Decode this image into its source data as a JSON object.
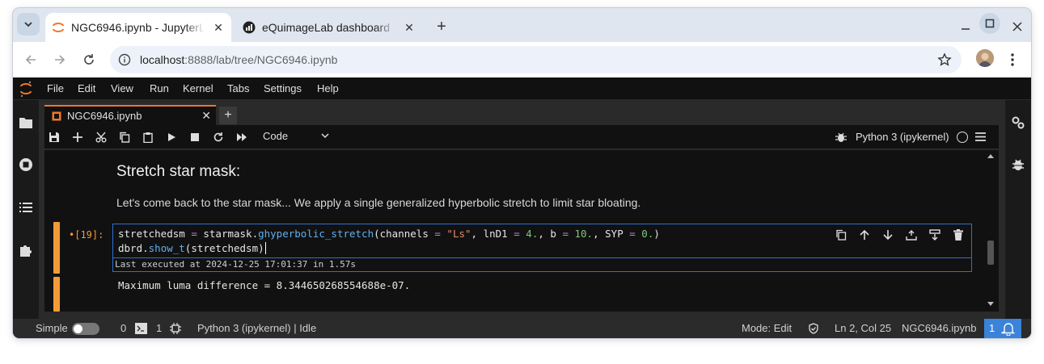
{
  "browser": {
    "tabs": [
      {
        "title": "NGC6946.ipynb - JupyterLab",
        "favicon": "jupyter-icon",
        "active": true
      },
      {
        "title": "eQuimageLab dashboard",
        "favicon": "dashboard-icon",
        "active": false
      }
    ],
    "new_tab": "+",
    "address": {
      "host": "localhost",
      "path": ":8888/lab/tree/NGC6946.ipynb"
    }
  },
  "jupyter": {
    "menu": [
      "File",
      "Edit",
      "View",
      "Run",
      "Kernel",
      "Tabs",
      "Settings",
      "Help"
    ],
    "doc_tab": {
      "title": "NGC6946.ipynb",
      "close": "✕",
      "add": "+"
    },
    "toolbar": {
      "cell_type": "Code",
      "kernel": "Python 3 (ipykernel)"
    },
    "markdown": {
      "heading": "Stretch star mask:",
      "paragraph": "Let's come back to the star mask... We apply a single generalized hyperbolic stretch to limit star bloating."
    },
    "cell": {
      "prompt": "•[19]:",
      "line1": {
        "a": "stretchedsm ",
        "eq": "=",
        "b": " starmask.",
        "fn": "ghyperbolic_stretch",
        "c": "(channels ",
        "eq2": "=",
        "s1": " \"Ls\"",
        "d": ", lnD1 ",
        "eq3": "=",
        "n1": " 4.",
        "e": ", b ",
        "eq4": "=",
        "n2": " 10.",
        "f": ", SYP ",
        "eq5": "=",
        "n3": " 0.",
        "g": ")"
      },
      "line2": {
        "a": "dbrd.",
        "fn": "show_t",
        "c": "(stretchedsm)"
      },
      "last_executed": "Last executed at 2024-12-25 17:01:37 in 1.57s",
      "output": "Maximum luma difference = 8.344650268554688e-07."
    },
    "status": {
      "mode_label": "Simple",
      "terminals": "0",
      "kernels": "1",
      "kernel_status": "Python 3 (ipykernel) | Idle",
      "edit_mode": "Mode: Edit",
      "position": "Ln 2, Col 25",
      "filename": "NGC6946.ipynb",
      "notifications": "1"
    }
  },
  "colors": {
    "accent": "#f37726",
    "selection": "#2f6fd1",
    "notification": "#3b82d9"
  }
}
